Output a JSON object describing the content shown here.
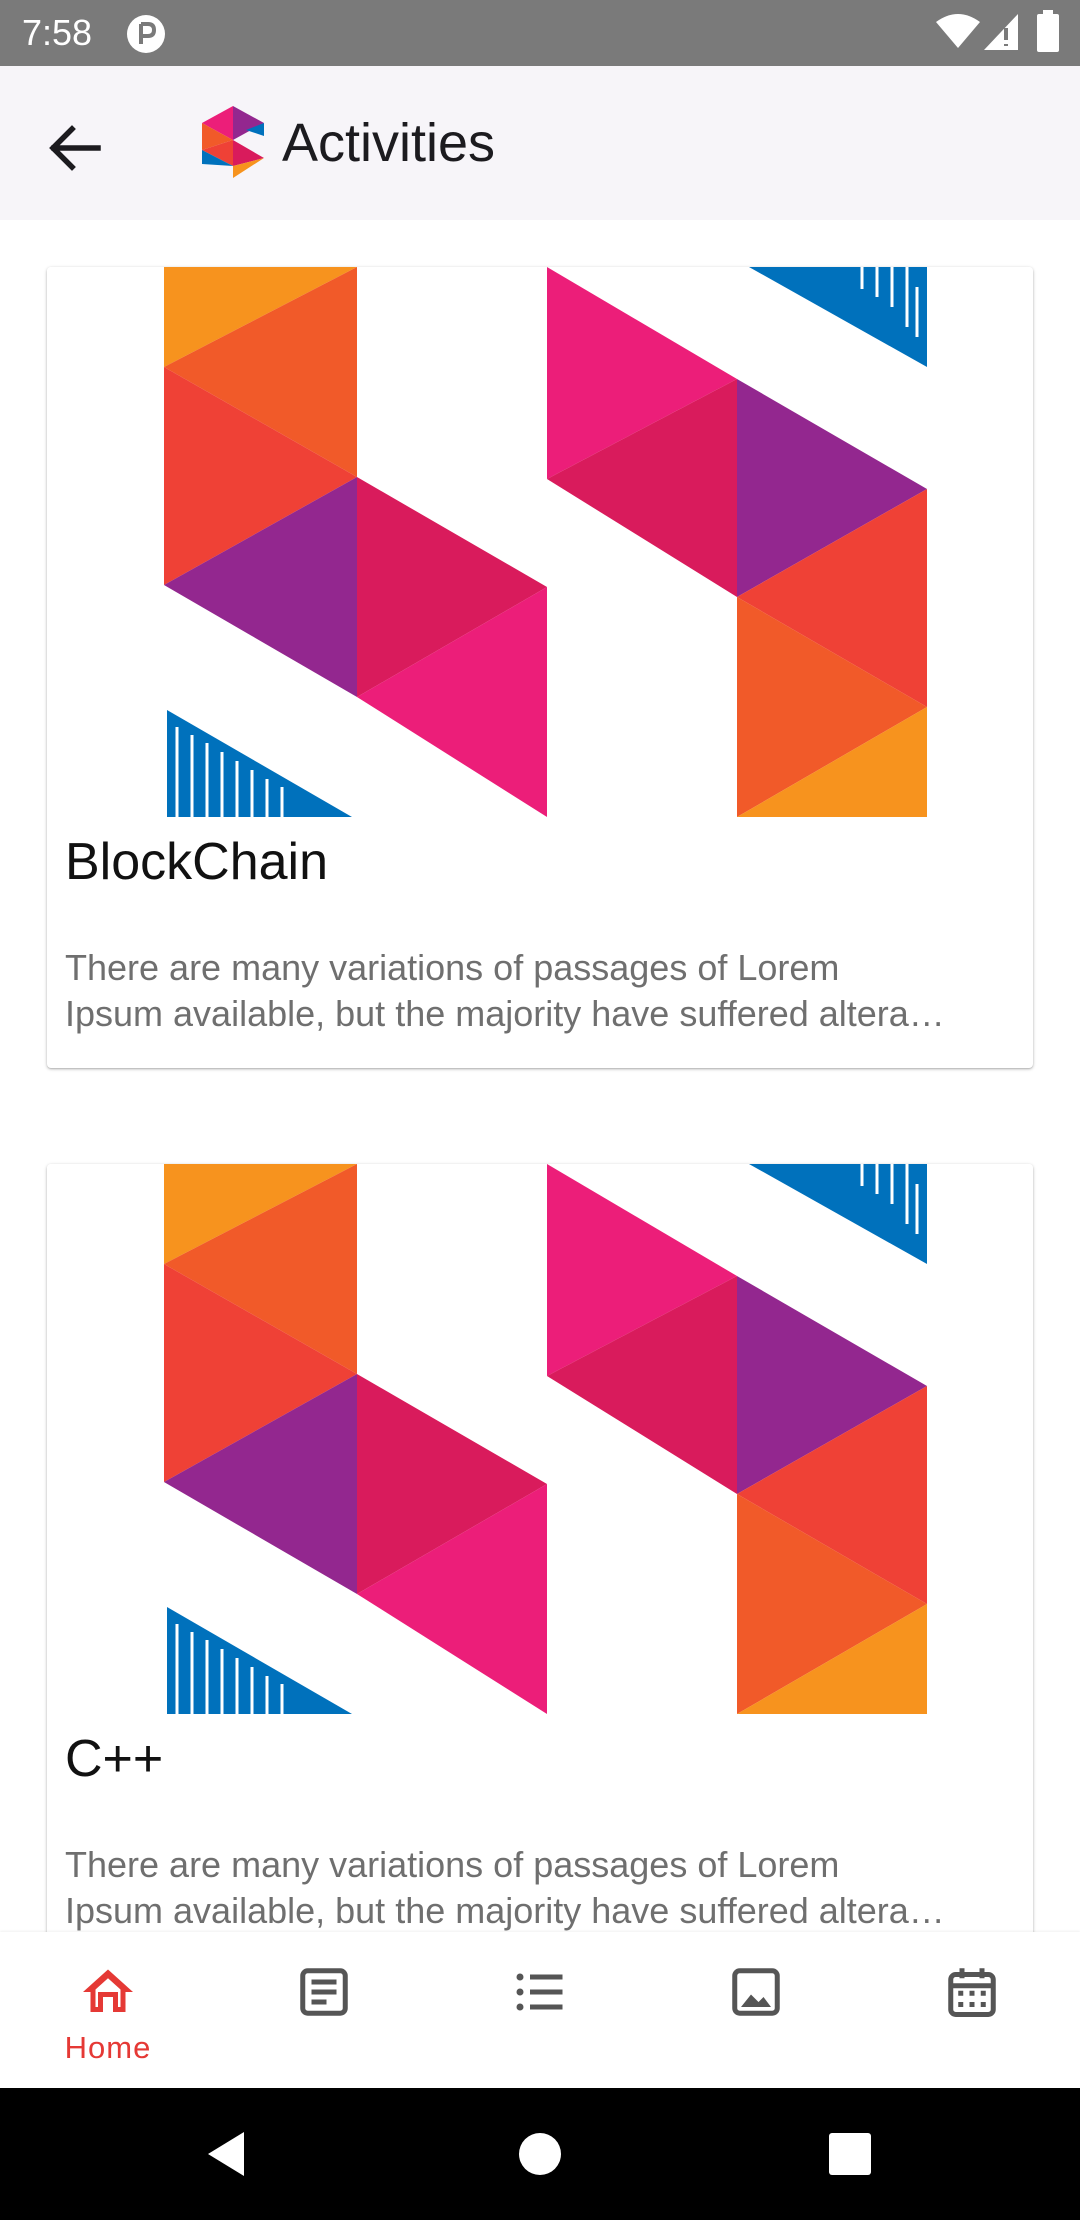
{
  "status_bar": {
    "time": "7:58",
    "icons": [
      "notification-p-icon",
      "wifi-icon",
      "signal-icon",
      "battery-icon"
    ]
  },
  "app_bar": {
    "title": "Activities",
    "back_icon": "arrow-left-icon",
    "logo_icon": "s-logo-icon"
  },
  "cards": [
    {
      "title": "BlockChain",
      "description_line1": "There are many variations of passages of Lorem",
      "description_line2": "Ipsum available, but the majority have suffered altera…"
    },
    {
      "title": "C++",
      "description_line1": "There are many variations of passages of Lorem",
      "description_line2": "Ipsum available, but the majority have suffered altera…"
    }
  ],
  "bottom_nav": {
    "items": [
      {
        "label": "Home",
        "icon": "home-icon",
        "active": true
      },
      {
        "label": "",
        "icon": "article-icon",
        "active": false
      },
      {
        "label": "",
        "icon": "list-icon",
        "active": false
      },
      {
        "label": "",
        "icon": "image-icon",
        "active": false
      },
      {
        "label": "",
        "icon": "calendar-icon",
        "active": false
      }
    ]
  },
  "colors": {
    "accent": "#e53935",
    "inactive_icon": "#555555",
    "status_bar": "#7a7a7a",
    "app_bar": "#f7f5f9",
    "orange": "#f7931e",
    "orange_dark": "#f15a29",
    "red": "#ef4136",
    "crimson": "#d91b5c",
    "magenta": "#ec1e79",
    "purple": "#93278f",
    "blue": "#0071bc"
  }
}
